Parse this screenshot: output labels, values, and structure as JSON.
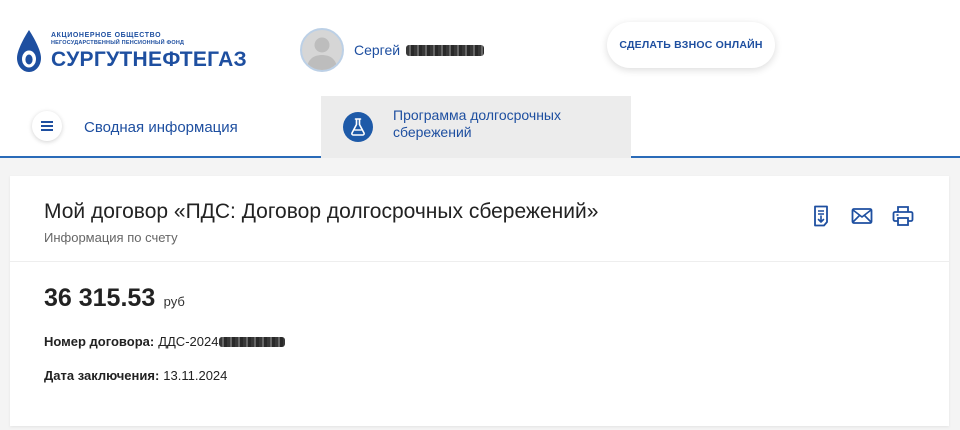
{
  "header": {
    "logo": {
      "line1": "АКЦИОНЕРНОЕ ОБЩЕСТВО",
      "line2": "НЕГОСУДАРСТВЕННЫЙ ПЕНСИОННЫЙ ФОНД",
      "name": "СУРГУТНЕФТЕГАЗ",
      "brand_color": "#1e4fa0"
    },
    "user": {
      "first_name": "Сергей"
    },
    "donate_button": "СДЕЛАТЬ ВЗНОС ОНЛАЙН"
  },
  "tabs": [
    {
      "label": "Сводная информация",
      "icon": "menu-icon",
      "active": false
    },
    {
      "label": "Программа долгосрочных сбережений",
      "icon": "flask-icon",
      "active": true
    }
  ],
  "contract": {
    "title": "Мой договор «ПДС: Договор долгосрочных сбережений»",
    "subtitle": "Информация по счету",
    "actions": [
      "statement-icon",
      "mail-icon",
      "print-icon"
    ],
    "balance": {
      "amount": "36 315.53",
      "currency": "руб"
    },
    "number_label": "Номер договора:",
    "number_value": "ДДС-2024",
    "date_label": "Дата заключения:",
    "date_value": "13.11.2024"
  },
  "colors": {
    "accent": "#1e4fa0",
    "tab_active_bg": "#ececec",
    "divider": "#2a6bb8"
  }
}
